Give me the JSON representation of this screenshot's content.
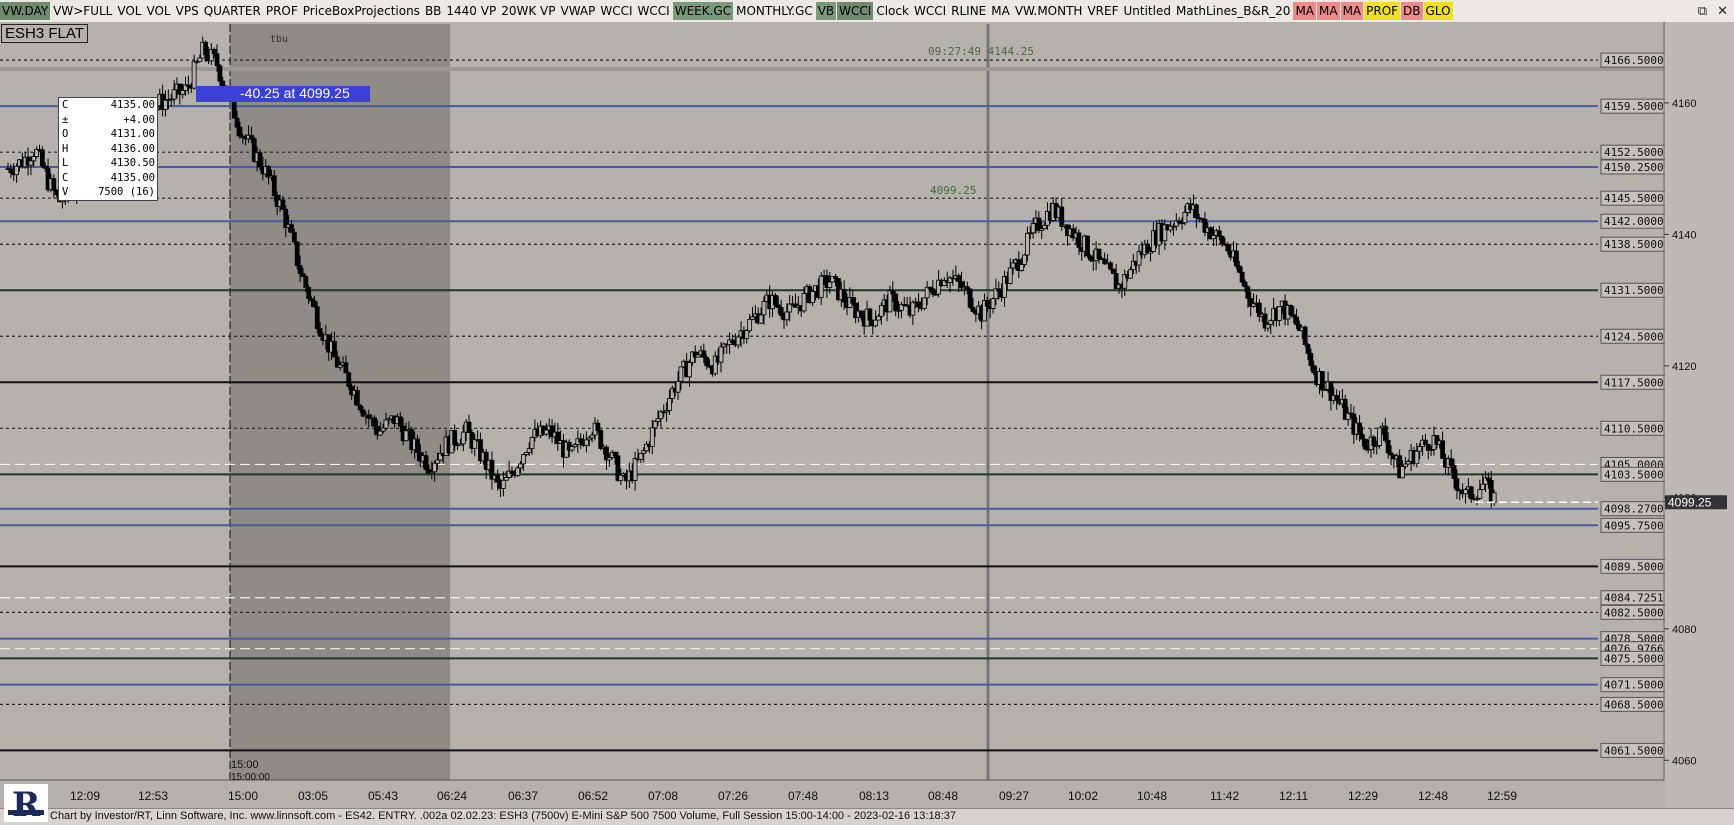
{
  "toolbar": {
    "buttons": [
      {
        "label": "VW.DAY",
        "style": "dk"
      },
      {
        "label": "VW>FULL",
        "style": ""
      },
      {
        "label": "VOL",
        "style": ""
      },
      {
        "label": "VOL",
        "style": ""
      },
      {
        "label": "VPS",
        "style": ""
      },
      {
        "label": "QUARTER",
        "style": ""
      },
      {
        "label": "PROF",
        "style": ""
      },
      {
        "label": "PriceBoxProjections",
        "style": ""
      },
      {
        "label": "BB",
        "style": ""
      },
      {
        "label": "1440 VP",
        "style": ""
      },
      {
        "label": "20WK VP",
        "style": ""
      },
      {
        "label": "VWAP",
        "style": ""
      },
      {
        "label": "WCCI",
        "style": ""
      },
      {
        "label": "WCCI",
        "style": ""
      },
      {
        "label": "WEEK.GC",
        "style": "grn"
      },
      {
        "label": "MONTHLY.GC",
        "style": ""
      },
      {
        "label": "VB",
        "style": "grn"
      },
      {
        "label": "WCCI",
        "style": "dk"
      },
      {
        "label": "Clock",
        "style": ""
      },
      {
        "label": "WCCI",
        "style": ""
      },
      {
        "label": "RLINE",
        "style": ""
      },
      {
        "label": "MA",
        "style": ""
      },
      {
        "label": "VW.MONTH",
        "style": ""
      },
      {
        "label": "VREF",
        "style": ""
      },
      {
        "label": "Untitled",
        "style": ""
      },
      {
        "label": "MathLines_B&R_20",
        "style": ""
      },
      {
        "label": "MA",
        "style": "pk"
      },
      {
        "label": "MA",
        "style": "pk"
      },
      {
        "label": "MA",
        "style": "pk"
      },
      {
        "label": "PROF",
        "style": "yl"
      },
      {
        "label": "DB",
        "style": "pk"
      },
      {
        "label": "GLO",
        "style": "yl"
      }
    ]
  },
  "window_controls": {
    "restore": "restore-icon",
    "close": "close-icon",
    "restore_glyph": "⧉",
    "close_glyph": "✕"
  },
  "symbol_label": "ESH3 FLAT",
  "ohlc_box": [
    {
      "k": "C",
      "v": "4135.00"
    },
    {
      "k": "±",
      "v": "+4.00"
    },
    {
      "k": "O",
      "v": "4131.00"
    },
    {
      "k": "H",
      "v": "4136.00"
    },
    {
      "k": "L",
      "v": "4130.50"
    },
    {
      "k": "C",
      "v": "4135.00"
    },
    {
      "k": "V",
      "v": "7500 (16)"
    }
  ],
  "status_bar": "Chart by Investor/RT, Linn Software, Inc. www.linnsoft.com - ES42.  ENTRY. .002a  02.02.23: ESH3 (7500v) E-Mini S&P 500 7500 Volume, Full Session 15:00-14:00 - 2023-02-16 13:18:37",
  "chart_data": {
    "type": "candlestick",
    "symbol": "ESH3",
    "ylim": [
      4057,
      4172
    ],
    "y_ticks": [
      4060,
      4080,
      4100,
      4120,
      4140,
      4160
    ],
    "x_tick_labels": [
      "12:09",
      "12:53",
      "15:00",
      "03:05",
      "05:43",
      "06:24",
      "06:37",
      "06:52",
      "07:08",
      "07:26",
      "07:48",
      "08:13",
      "08:48",
      "09:27",
      "10:02",
      "10:48",
      "11:42",
      "12:11",
      "12:29",
      "12:48",
      "12:59"
    ],
    "current_price": "4099.25",
    "price_levels": [
      {
        "price": 4166.5,
        "label": "4166.5000",
        "style": "dotted",
        "color": "#222222"
      },
      {
        "price": 4159.5,
        "label": "4159.5000",
        "style": "solid",
        "color": "#4a5aa0"
      },
      {
        "price": 4152.5,
        "label": "4152.5000",
        "style": "dotted",
        "color": "#222222"
      },
      {
        "price": 4150.25,
        "label": "4150.2500",
        "style": "solid",
        "color": "#4a5aa0"
      },
      {
        "price": 4145.5,
        "label": "4145.5000",
        "style": "dotted",
        "color": "#222222"
      },
      {
        "price": 4142.0,
        "label": "4142.0000",
        "style": "solid",
        "color": "#4a5aa0"
      },
      {
        "price": 4138.5,
        "label": "4138.5000",
        "style": "dotted",
        "color": "#222222"
      },
      {
        "price": 4131.5,
        "label": "4131.5000",
        "style": "solid",
        "color": "#203828"
      },
      {
        "price": 4124.5,
        "label": "4124.5000",
        "style": "dotted",
        "color": "#222222"
      },
      {
        "price": 4117.5,
        "label": "4117.5000",
        "style": "solid",
        "color": "#111111"
      },
      {
        "price": 4110.5,
        "label": "4110.5000",
        "style": "dotted",
        "color": "#222222"
      },
      {
        "price": 4105.0,
        "label": "4105.0000",
        "style": "dashed",
        "color": "#f4f4f4"
      },
      {
        "price": 4103.5,
        "label": "4103.5000",
        "style": "solid",
        "color": "#203828"
      },
      {
        "price": 4098.27,
        "label": "4098.2700",
        "style": "solid",
        "color": "#4a5aa0"
      },
      {
        "price": 4095.75,
        "label": "4095.7500",
        "style": "solid",
        "color": "#4a5aa0"
      },
      {
        "price": 4089.5,
        "label": "4089.5000",
        "style": "solid",
        "color": "#111111"
      },
      {
        "price": 4084.7251,
        "label": "4084.7251",
        "style": "dashed",
        "color": "#f4f4f4"
      },
      {
        "price": 4082.5,
        "label": "4082.5000",
        "style": "dotted",
        "color": "#222222"
      },
      {
        "price": 4078.5,
        "label": "4078.5000",
        "style": "solid",
        "color": "#4a5aa0"
      },
      {
        "price": 4076.9766,
        "label": "4076.9766",
        "style": "dashed",
        "color": "#f4f4f4"
      },
      {
        "price": 4075.5,
        "label": "4075.5000",
        "style": "solid",
        "color": "#203828"
      },
      {
        "price": 4071.5,
        "label": "4071.5000",
        "style": "solid",
        "color": "#4a5aa0"
      },
      {
        "price": 4068.5,
        "label": "4068.5000",
        "style": "dotted",
        "color": "#222222"
      },
      {
        "price": 4061.5,
        "label": "4061.5000",
        "style": "solid",
        "color": "#111111"
      }
    ],
    "annotations": [
      {
        "text": "09:27:49  4144.25",
        "price": 4166.0
      },
      {
        "text": "4099.25",
        "price": 4145.0
      },
      {
        "text": "-40.25 at 4099.25",
        "price": 4159.25
      },
      {
        "text": "15:00",
        "price": 4061.0
      },
      {
        "text": "15:00:00",
        "price": 4059.0
      },
      {
        "text": "tbu",
        "price": 4167.0
      }
    ],
    "path": [
      [
        0,
        4150
      ],
      [
        0.4,
        4151
      ],
      [
        0.8,
        4153
      ],
      [
        1.2,
        4148
      ],
      [
        1.5,
        4145
      ],
      [
        2.0,
        4147
      ],
      [
        2.3,
        4150
      ],
      [
        2.6,
        4155
      ],
      [
        3.2,
        4157
      ],
      [
        3.8,
        4158
      ],
      [
        4.5,
        4160
      ],
      [
        5.3,
        4162
      ],
      [
        5.8,
        4168
      ],
      [
        6.2,
        4166
      ],
      [
        6.6,
        4160
      ],
      [
        7.0,
        4155
      ],
      [
        7.6,
        4150
      ],
      [
        8.2,
        4143
      ],
      [
        8.7,
        4134
      ],
      [
        9.2,
        4127
      ],
      [
        9.7,
        4121
      ],
      [
        10.2,
        4117
      ],
      [
        10.6,
        4113
      ],
      [
        11.0,
        4110
      ],
      [
        11.5,
        4112
      ],
      [
        12.0,
        4108
      ],
      [
        12.5,
        4105
      ],
      [
        13.0,
        4108
      ],
      [
        13.6,
        4110
      ],
      [
        14.1,
        4106
      ],
      [
        14.6,
        4101
      ],
      [
        15.0,
        4104
      ],
      [
        15.5,
        4109
      ],
      [
        16.1,
        4110
      ],
      [
        16.7,
        4106
      ],
      [
        17.3,
        4111
      ],
      [
        17.8,
        4107
      ],
      [
        18.3,
        4102
      ],
      [
        18.8,
        4106
      ],
      [
        19.3,
        4112
      ],
      [
        19.8,
        4117
      ],
      [
        20.4,
        4122
      ],
      [
        21.0,
        4120
      ],
      [
        21.5,
        4124
      ],
      [
        22.1,
        4127
      ],
      [
        22.6,
        4130
      ],
      [
        23.2,
        4128
      ],
      [
        23.8,
        4131
      ],
      [
        24.4,
        4133
      ],
      [
        25.0,
        4129
      ],
      [
        25.6,
        4127
      ],
      [
        26.2,
        4130
      ],
      [
        26.8,
        4128
      ],
      [
        27.3,
        4131
      ],
      [
        27.8,
        4134
      ],
      [
        28.3,
        4132
      ],
      [
        28.9,
        4128
      ],
      [
        29.5,
        4132
      ],
      [
        30.0,
        4136
      ],
      [
        30.5,
        4141
      ],
      [
        31.0,
        4144
      ],
      [
        31.5,
        4141
      ],
      [
        32.0,
        4138
      ],
      [
        32.5,
        4135
      ],
      [
        33.0,
        4132
      ],
      [
        33.6,
        4137
      ],
      [
        34.1,
        4140
      ],
      [
        34.6,
        4142
      ],
      [
        35.1,
        4144
      ],
      [
        35.6,
        4141
      ],
      [
        36.2,
        4138
      ],
      [
        36.8,
        4131
      ],
      [
        37.3,
        4127
      ],
      [
        37.8,
        4129
      ],
      [
        38.3,
        4126
      ],
      [
        38.8,
        4119
      ],
      [
        39.3,
        4116
      ],
      [
        39.8,
        4112
      ],
      [
        40.3,
        4108
      ],
      [
        40.8,
        4110
      ],
      [
        41.3,
        4104
      ],
      [
        41.8,
        4107
      ],
      [
        42.3,
        4109
      ],
      [
        42.8,
        4104
      ],
      [
        43.3,
        4100
      ],
      [
        43.8,
        4102
      ],
      [
        44.2,
        4099.25
      ]
    ]
  }
}
